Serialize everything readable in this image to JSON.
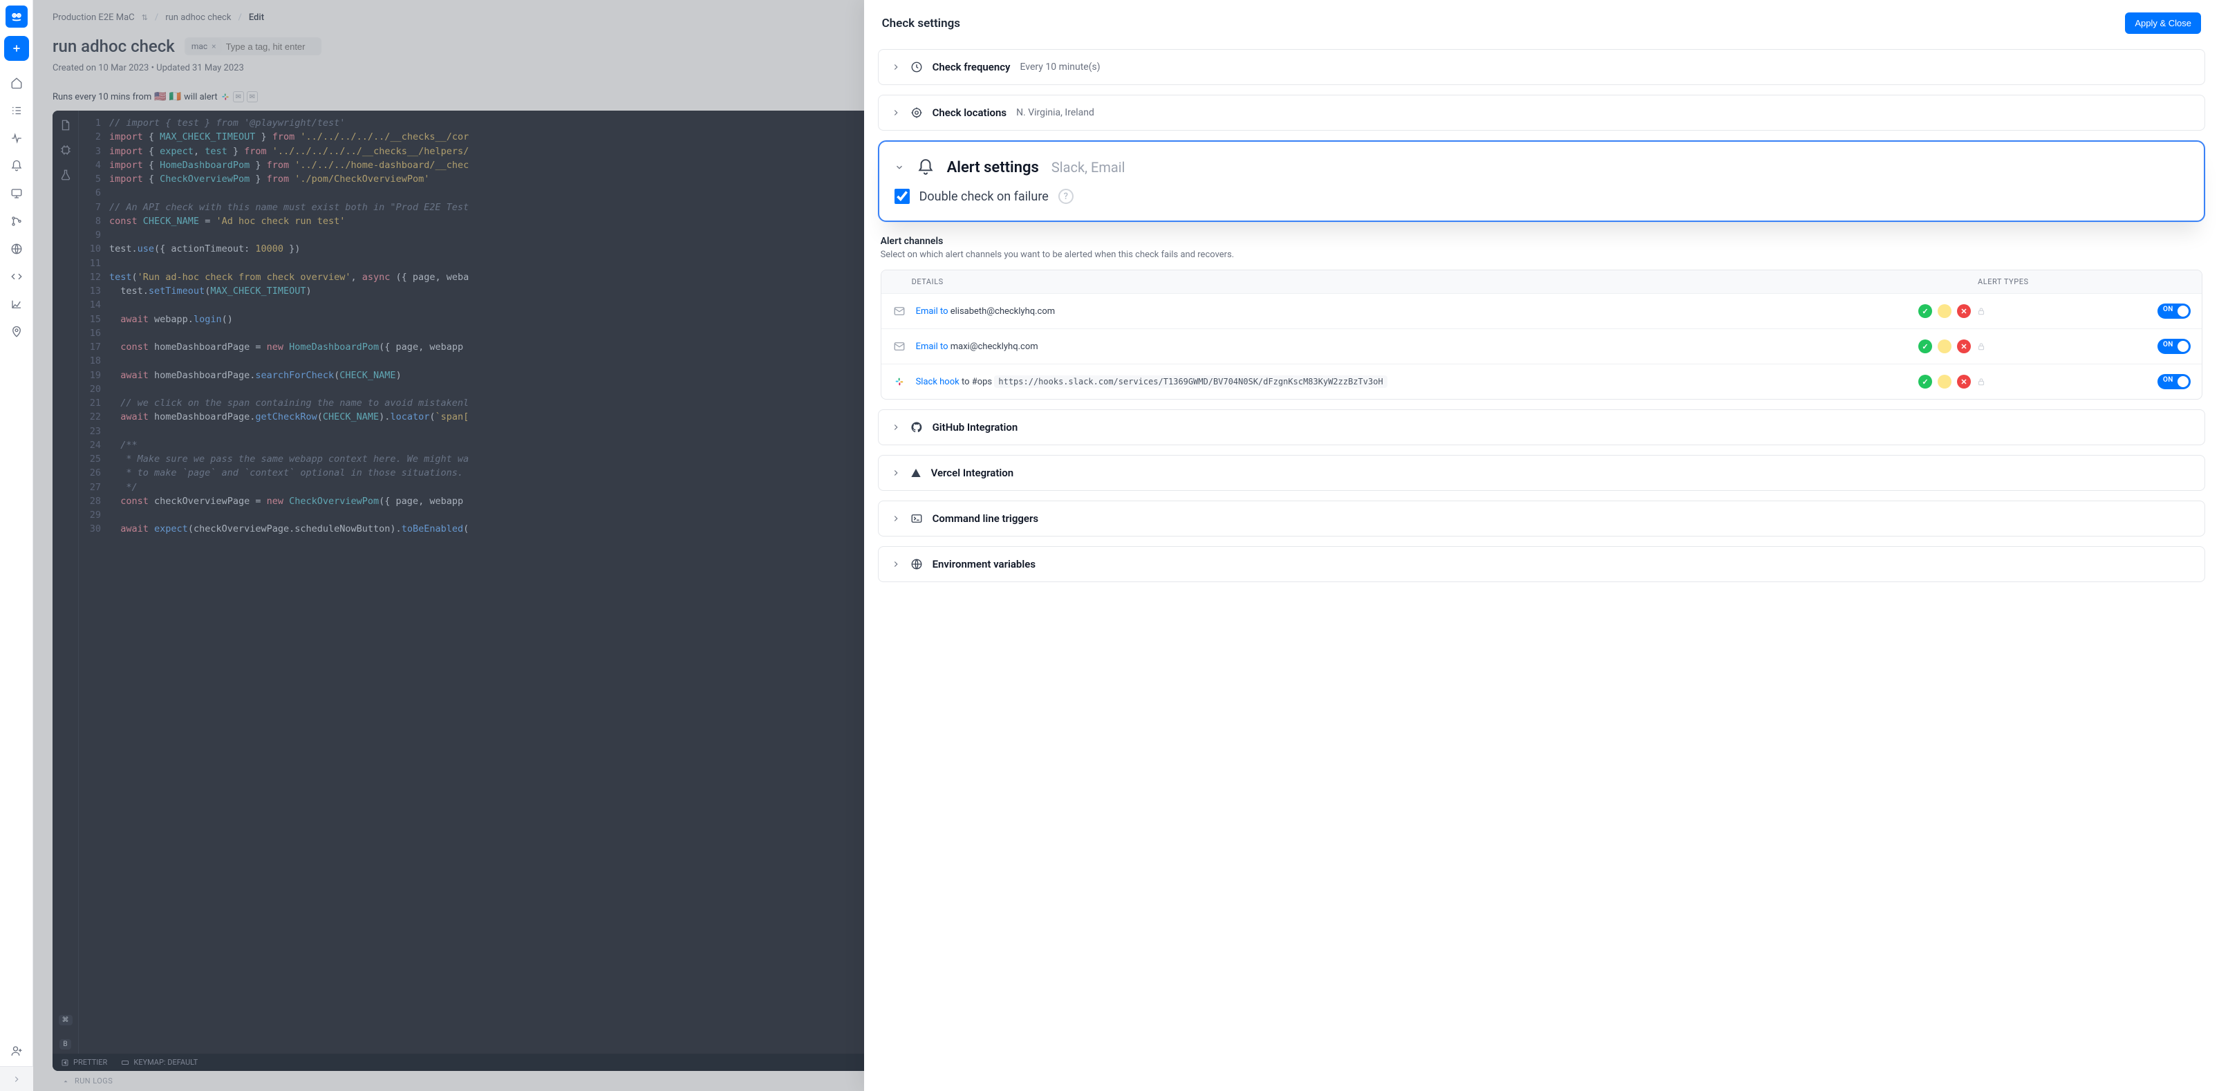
{
  "breadcrumbs": {
    "root": "Production E2E MaC",
    "mid": "run adhoc check",
    "leaf": "Edit"
  },
  "page": {
    "title": "run adhoc check",
    "tag": "mac",
    "tag_placeholder": "Type a tag, hit enter",
    "created": "Created on 10 Mar 2023 • Updated 31 May 2023",
    "runs_prefix": "Runs every 10 mins from",
    "runs_alert": "will alert",
    "runlogs": "RUN LOGS"
  },
  "editor": {
    "footer_prettier": "PRETTIER",
    "footer_keymap": "KEYMAP: DEFAULT",
    "kbd1": "⌘",
    "kbd2": "B"
  },
  "panel": {
    "title": "Check settings",
    "apply": "Apply & Close",
    "freq_title": "Check frequency",
    "freq_sub": "Every 10 minute(s)",
    "loc_title": "Check locations",
    "loc_sub": "N. Virginia, Ireland",
    "alert_title": "Alert settings",
    "alert_sub": "Slack, Email",
    "double_check": "Double check on failure",
    "channels_heading": "Alert channels",
    "channels_desc": "Select on which alert channels you want to be alerted when this check fails and recovers.",
    "th_details": "DETAILS",
    "th_types": "ALERT TYPES",
    "github": "GitHub Integration",
    "vercel": "Vercel Integration",
    "cli": "Command line triggers",
    "env": "Environment variables"
  },
  "channels": [
    {
      "kind": "email",
      "prefix": "Email to",
      "to": "elisabeth@checklyhq.com",
      "on": "ON"
    },
    {
      "kind": "email",
      "prefix": "Email to",
      "to": "maxi@checklyhq.com",
      "on": "ON"
    },
    {
      "kind": "slack",
      "prefix": "Slack hook",
      "join": "to",
      "channel": "#ops",
      "url": "https://hooks.slack.com/services/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",
      "on": "ON"
    }
  ],
  "code": [
    {
      "n": 1,
      "h": "<span class='c-comm'>// import { test } from '@playwright/test'</span>"
    },
    {
      "n": 2,
      "h": "<span class='c-kw'>import</span> { <span class='c-id'>MAX_CHECK_TIMEOUT</span> } <span class='c-kw'>from</span> <span class='c-str'>'../../../../../__checks__/cor</span>"
    },
    {
      "n": 3,
      "h": "<span class='c-kw'>import</span> { <span class='c-id'>expect</span>, <span class='c-id'>test</span> } <span class='c-kw'>from</span> <span class='c-str'>'../../../../../__checks__/helpers/</span>"
    },
    {
      "n": 4,
      "h": "<span class='c-kw'>import</span> { <span class='c-id'>HomeDashboardPom</span> } <span class='c-kw'>from</span> <span class='c-str'>'../../../home-dashboard/__chec</span>"
    },
    {
      "n": 5,
      "h": "<span class='c-kw'>import</span> { <span class='c-id'>CheckOverviewPom</span> } <span class='c-kw'>from</span> <span class='c-str'>'./pom/CheckOverviewPom'</span>"
    },
    {
      "n": 6,
      "h": ""
    },
    {
      "n": 7,
      "h": "<span class='c-comm'>// An API check with this name must exist both in \"Prod E2E Test</span>"
    },
    {
      "n": 8,
      "h": "<span class='c-kw'>const</span> <span class='c-id'>CHECK_NAME</span> = <span class='c-str'>'Ad hoc check run test'</span>"
    },
    {
      "n": 9,
      "h": ""
    },
    {
      "n": 10,
      "h": "test.<span class='c-fn'>use</span>({ actionTimeout: <span class='c-num'>10000</span> })"
    },
    {
      "n": 11,
      "h": ""
    },
    {
      "n": 12,
      "h": "<span class='c-fn'>test</span>(<span class='c-str'>'Run ad-hoc check from check overview'</span>, <span class='c-kw'>async</span> ({ page, weba"
    },
    {
      "n": 13,
      "h": "  test.<span class='c-fn'>setTimeout</span>(<span class='c-id'>MAX_CHECK_TIMEOUT</span>)"
    },
    {
      "n": 14,
      "h": ""
    },
    {
      "n": 15,
      "h": "  <span class='c-kw'>await</span> webapp.<span class='c-fn'>login</span>()"
    },
    {
      "n": 16,
      "h": ""
    },
    {
      "n": 17,
      "h": "  <span class='c-kw'>const</span> homeDashboardPage = <span class='c-kw'>new</span> <span class='c-id'>HomeDashboardPom</span>({ page, webapp "
    },
    {
      "n": 18,
      "h": ""
    },
    {
      "n": 19,
      "h": "  <span class='c-kw'>await</span> homeDashboardPage.<span class='c-fn'>searchForCheck</span>(<span class='c-id'>CHECK_NAME</span>)"
    },
    {
      "n": 20,
      "h": ""
    },
    {
      "n": 21,
      "h": "  <span class='c-comm'>// we click on the span containing the name to avoid mistakenl</span>"
    },
    {
      "n": 22,
      "h": "  <span class='c-kw'>await</span> homeDashboardPage.<span class='c-fn'>getCheckRow</span>(<span class='c-id'>CHECK_NAME</span>).<span class='c-fn'>locator</span>(<span class='c-str'>`span[</span>"
    },
    {
      "n": 23,
      "h": ""
    },
    {
      "n": 24,
      "h": "  <span class='c-comm'>/**</span>"
    },
    {
      "n": 25,
      "h": "<span class='c-comm'>   * Make sure we pass the same webapp context here. We might wa</span>"
    },
    {
      "n": 26,
      "h": "<span class='c-comm'>   * to make `page` and `context` optional in those situations.</span>"
    },
    {
      "n": 27,
      "h": "<span class='c-comm'>   */</span>"
    },
    {
      "n": 28,
      "h": "  <span class='c-kw'>const</span> checkOverviewPage = <span class='c-kw'>new</span> <span class='c-id'>CheckOverviewPom</span>({ page, webapp "
    },
    {
      "n": 29,
      "h": ""
    },
    {
      "n": 30,
      "h": "  <span class='c-kw'>await</span> <span class='c-fn'>expect</span>(checkOverviewPage.scheduleNowButton).<span class='c-fn'>toBeEnabled</span>("
    }
  ]
}
